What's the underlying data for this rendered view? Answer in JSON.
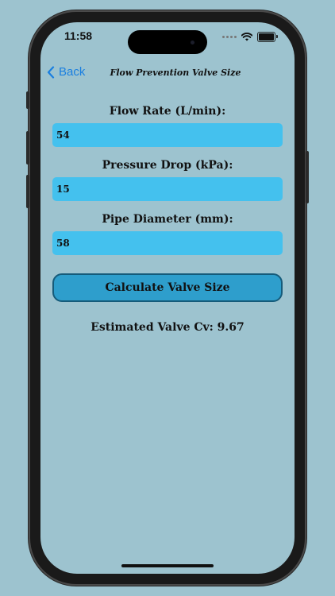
{
  "status_bar": {
    "time": "11:58"
  },
  "nav": {
    "back_label": "Back",
    "title": "Flow Prevention Valve Size"
  },
  "form": {
    "flow_rate": {
      "label": "Flow Rate (L/min):",
      "value": "54"
    },
    "pressure_drop": {
      "label": "Pressure Drop (kPa):",
      "value": "15"
    },
    "pipe_diameter": {
      "label": "Pipe Diameter (mm):",
      "value": "58"
    },
    "calculate_label": "Calculate Valve Size"
  },
  "result": {
    "text": "Estimated Valve Cv: 9.67"
  },
  "colors": {
    "background": "#9dc3cf",
    "input_fill": "#44c1ee",
    "button_fill": "#2e9ecc",
    "button_border": "#155b7a",
    "link": "#1a7fe0"
  },
  "icons": [
    "chevron-left-icon",
    "wifi-icon",
    "battery-icon",
    "signal-dots-icon"
  ]
}
